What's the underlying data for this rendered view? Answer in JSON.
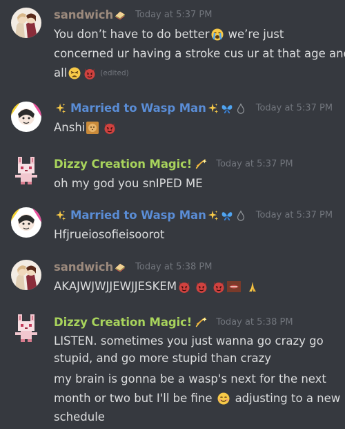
{
  "messages": [
    {
      "author": "sandwich",
      "timestamp": "Today at 5:37 PM",
      "lines": [
        "You don’t have to do better",
        "we’re just",
        "concerned ur having a stroke cus ur at that age and",
        "all"
      ],
      "edited": "(edited)"
    },
    {
      "author": "Married to Wasp Man",
      "timestamp": "Today at 5:37 PM",
      "lines": [
        "Anshi"
      ]
    },
    {
      "author": "Dizzy Creation Magic!",
      "timestamp": "Today at 5:37 PM",
      "lines": [
        "oh my god you snIPED ME"
      ]
    },
    {
      "author": "Married to Wasp Man",
      "timestamp": "Today at 5:37 PM",
      "lines": [
        "Hfjrueiosofieisoorot"
      ]
    },
    {
      "author": "sandwich",
      "timestamp": "Today at 5:38 PM",
      "lines": [
        "AKAJWJWJJEWJJESKEM"
      ]
    },
    {
      "author": "Dizzy Creation Magic!",
      "timestamp": "Today at 5:38 PM",
      "lines": [
        "LISTEN. sometimes you just wanna go crazy go",
        "stupid, and go more stupid than crazy",
        "my brain is gonna be a wasp's next for the next",
        "month or two but I'll be fine",
        "adjusting to a new",
        "schedule"
      ]
    }
  ],
  "colors": {
    "background": "#36393f",
    "sandwich": "#9c8a7d",
    "wasp": "#5a8dd6",
    "dizzy": "#a8d35c",
    "timestamp": "#72767d",
    "text": "#dcddde"
  },
  "icons": [
    "sandwich-emoji",
    "sparkles-emoji",
    "butterfly-emoji",
    "drop-icon",
    "dizzy-emoji",
    "crying-face-emoji",
    "weary-face-emoji",
    "devil-face-emoji",
    "lion-emoji",
    "folded-hands-emoji",
    "smiling-face-emoji",
    "mouth-emoji"
  ]
}
